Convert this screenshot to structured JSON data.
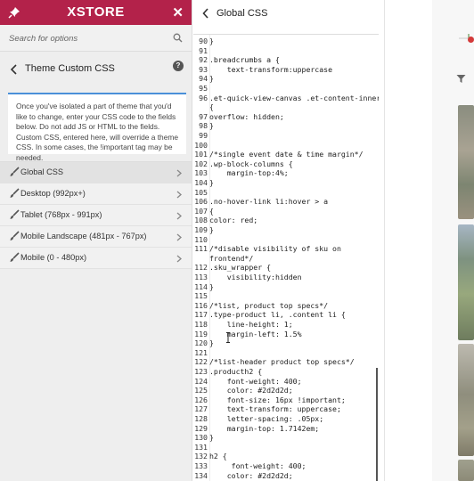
{
  "brand": {
    "logo_text": "XSTORE",
    "accent": "#b3224a"
  },
  "search": {
    "placeholder": "Search for options"
  },
  "section": {
    "title": "Theme Custom CSS",
    "description": "Once you've isolated a part of theme that you'd like to change, enter your CSS code to the fields below. Do not add JS or HTML to the fields. Custom CSS, entered here, will override a theme CSS. In some cases, the !important tag may be needed."
  },
  "menu": [
    {
      "label": "Global CSS",
      "active": true
    },
    {
      "label": "Desktop (992px+)"
    },
    {
      "label": "Tablet (768px - 991px)"
    },
    {
      "label": "Mobile Landscape (481px - 767px)"
    },
    {
      "label": "Mobile (0 - 480px)"
    }
  ],
  "editor": {
    "title": "Global CSS",
    "lines": [
      {
        "num": "90",
        "text": "}"
      },
      {
        "num": "91",
        "text": ""
      },
      {
        "num": "92",
        "text": ".breadcrumbs a {"
      },
      {
        "num": "93",
        "text": "    text-transform:uppercase"
      },
      {
        "num": "94",
        "text": "}"
      },
      {
        "num": "95",
        "text": ""
      },
      {
        "num": "96",
        "text": ".et-quick-view-canvas .et-content-inner"
      },
      {
        "num": "",
        "text": "{"
      },
      {
        "num": "97",
        "text": "overflow: hidden;"
      },
      {
        "num": "98",
        "text": "}"
      },
      {
        "num": "99",
        "text": ""
      },
      {
        "num": "100",
        "text": ""
      },
      {
        "num": "101",
        "text": "/*single event date & time margin*/"
      },
      {
        "num": "102",
        "text": ".wp-block-columns {"
      },
      {
        "num": "103",
        "text": "    margin-top:4%;"
      },
      {
        "num": "104",
        "text": "}"
      },
      {
        "num": "105",
        "text": ""
      },
      {
        "num": "106",
        "text": ".no-hover-link li:hover > a"
      },
      {
        "num": "107",
        "text": "{"
      },
      {
        "num": "108",
        "text": "color: red;"
      },
      {
        "num": "109",
        "text": "}"
      },
      {
        "num": "110",
        "text": ""
      },
      {
        "num": "111",
        "text": "/*disable visibility of sku on"
      },
      {
        "num": "",
        "text": "frontend*/"
      },
      {
        "num": "112",
        "text": ".sku_wrapper {"
      },
      {
        "num": "113",
        "text": "    visibility:hidden"
      },
      {
        "num": "114",
        "text": "}"
      },
      {
        "num": "115",
        "text": ""
      },
      {
        "num": "116",
        "text": "/*list, product top specs*/"
      },
      {
        "num": "117",
        "text": ".type-product li, .content li {"
      },
      {
        "num": "118",
        "text": "    line-height: 1;"
      },
      {
        "num": "119",
        "text": "    margin-left: 1.5%"
      },
      {
        "num": "120",
        "text": "}"
      },
      {
        "num": "121",
        "text": ""
      },
      {
        "num": "122",
        "text": "/*list-header product top specs*/"
      },
      {
        "num": "123",
        "text": ".producth2 {"
      },
      {
        "num": "124",
        "text": "    font-weight: 400;"
      },
      {
        "num": "125",
        "text": "    color: #2d2d2d;"
      },
      {
        "num": "126",
        "text": "    font-size: 16px !important;"
      },
      {
        "num": "127",
        "text": "    text-transform: uppercase;"
      },
      {
        "num": "128",
        "text": "    letter-spacing: .05px;"
      },
      {
        "num": "129",
        "text": "    margin-top: 1.7142em;"
      },
      {
        "num": "130",
        "text": "}"
      },
      {
        "num": "131",
        "text": ""
      },
      {
        "num": "132",
        "text": "h2 {"
      },
      {
        "num": "133",
        "text": "     font-weight: 400;"
      },
      {
        "num": "134",
        "text": "    color: #2d2d2d;"
      }
    ]
  },
  "icons": {
    "pin": "pin-icon",
    "close": "close-icon",
    "search": "search-icon",
    "back": "chevron-left-icon",
    "help": "help-icon",
    "brush": "brush-icon",
    "chevron": "chevron-right-icon",
    "filter": "filter-icon"
  },
  "help_glyph": "?",
  "close_glyph": "✕"
}
